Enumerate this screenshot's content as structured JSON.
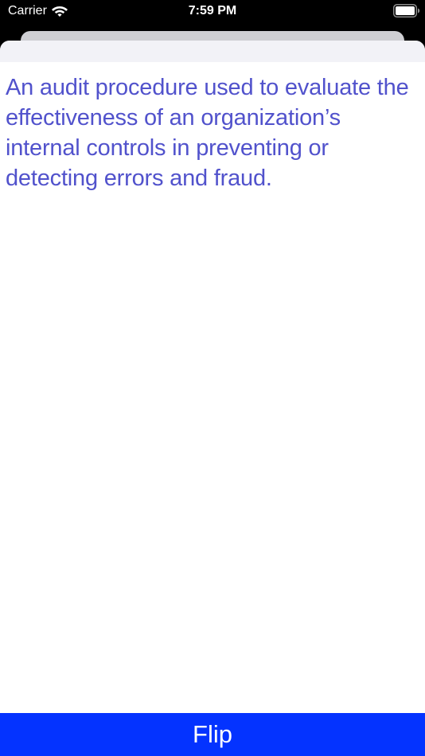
{
  "status_bar": {
    "carrier": "Carrier",
    "time": "7:59 PM",
    "wifi_icon": "wifi-icon",
    "battery_icon": "battery-full-icon"
  },
  "card": {
    "text": "An audit procedure used to evaluate the effectiveness of an organization’s internal controls in preventing or detecting errors and fraud."
  },
  "flip_button": {
    "label": "Flip"
  },
  "colors": {
    "text_accent": "#5152cc",
    "button_background": "#0433ff",
    "status_bar_background": "#000000",
    "sheet_header": "#f2f2f7"
  }
}
